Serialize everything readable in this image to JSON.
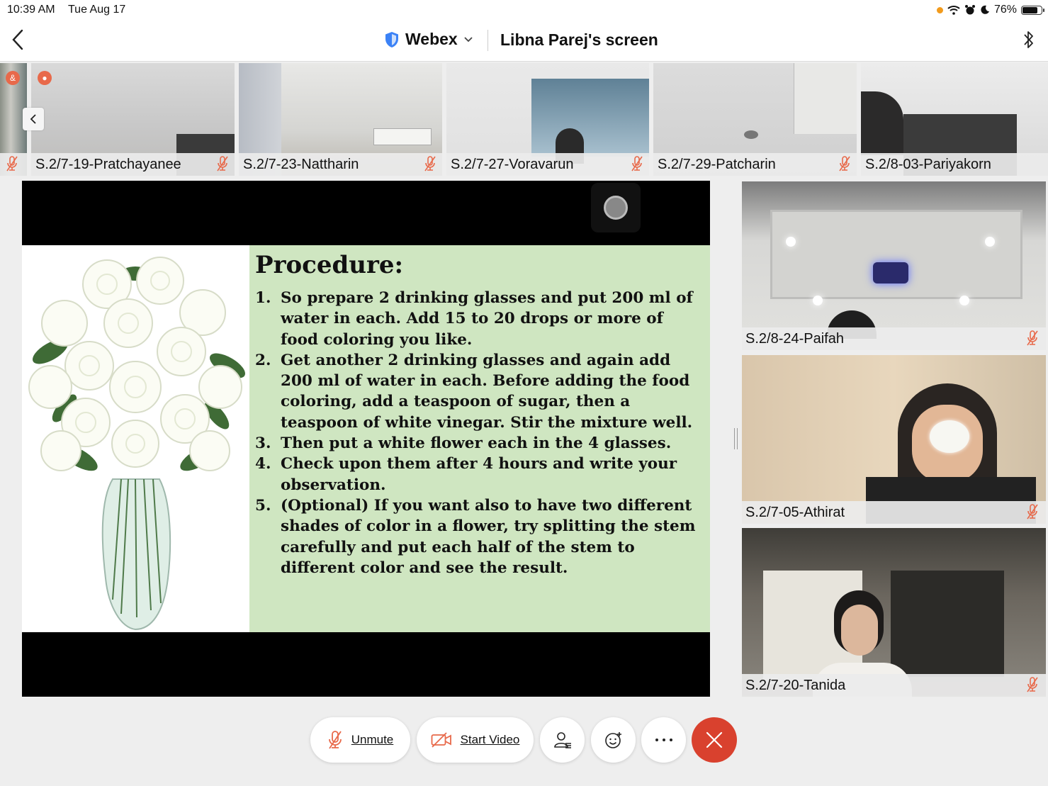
{
  "status": {
    "time": "10:39 AM",
    "date": "Tue Aug 17",
    "battery": "76%",
    "battery_level": 0.76
  },
  "header": {
    "app_name": "Webex",
    "screen_title": "Libna Parej's screen"
  },
  "participants_strip": [
    {
      "name": "S.2/7-19-Pratchayanee"
    },
    {
      "name": "S.2/7-23-Nattharin"
    },
    {
      "name": "S.2/7-27-Voravarun"
    },
    {
      "name": "S.2/7-29-Patcharin"
    },
    {
      "name": "S.2/8-03-Pariyakorn"
    }
  ],
  "shared_slide": {
    "title": "Procedure:",
    "steps": [
      {
        "num": "1.",
        "text": "So prepare 2 drinking glasses and put 200 ml of water in each. Add 15 to 20 drops or more of food coloring you like."
      },
      {
        "num": "2.",
        "text": "Get another 2 drinking glasses and again add 200 ml of water in each. Before adding the food coloring, add a teaspoon of sugar, then a teaspoon of white vinegar. Stir the mixture well."
      },
      {
        "num": "3.",
        "text": "Then put a white flower each in the 4 glasses."
      },
      {
        "num": "4.",
        "text": "Check upon them after 4 hours and write your observation."
      },
      {
        "num": "5.",
        "text": "(Optional) If you want also to have two different shades of color in a flower, try splitting the stem carefully and put each half of the stem to different color and see the result."
      }
    ]
  },
  "gallery": [
    {
      "name": "S.2/8-24-Paifah"
    },
    {
      "name": "S.2/7-05-Athirat"
    },
    {
      "name": "S.2/7-20-Tanida"
    }
  ],
  "controls": {
    "unmute_label": "Unmute",
    "start_video_label": "Start Video"
  },
  "colors": {
    "end_call": "#d9412e",
    "muted_mic": "#e8694a",
    "webex_shield": "#3b82f6",
    "slide_background": "#cfe6c1"
  }
}
